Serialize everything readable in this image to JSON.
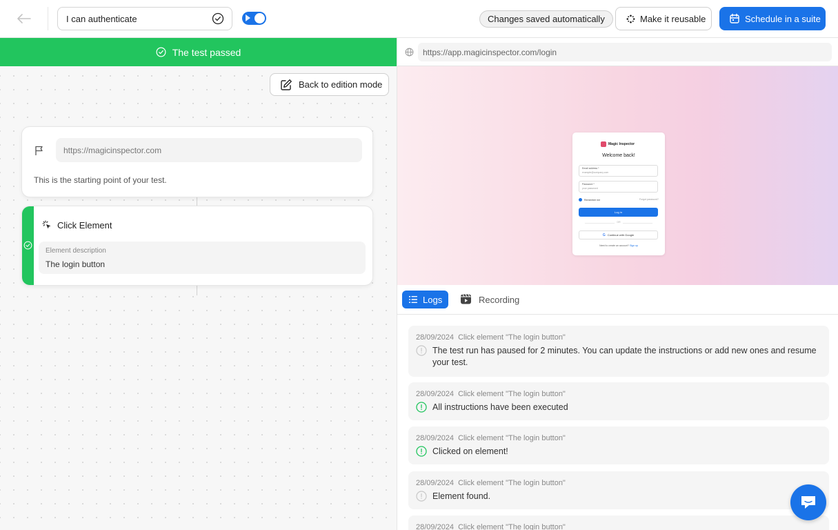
{
  "header": {
    "test_title": "I can authenticate",
    "saved_status": "Changes saved automatically",
    "reuse_label": "Make it reusable",
    "schedule_label": "Schedule in a suite"
  },
  "left": {
    "banner_text": "The test passed",
    "edit_mode_label": "Back to edition mode",
    "start_card": {
      "url": "https://magicinspector.com",
      "description": "This is the starting point of your test."
    },
    "step_card": {
      "title": "Click Element",
      "field_label": "Element description",
      "field_value": "The login button"
    }
  },
  "right": {
    "url": "https://app.magicinspector.com/login",
    "preview": {
      "brand": "Magic Inspector",
      "welcome": "Welcome back!",
      "email_label": "Email address *",
      "email_placeholder": "example@company.com",
      "password_label": "Password *",
      "password_placeholder": "your password",
      "remember": "Remember me",
      "forgot": "Forgot password?",
      "login_button": "Log in",
      "or": "OR",
      "google_button": "Continue with Google",
      "signup_prompt": "Need to create an account?",
      "signup_link": "Sign up"
    },
    "tabs": {
      "logs": "Logs",
      "recording": "Recording"
    },
    "logs": [
      {
        "date": "28/09/2024",
        "action": "Click element \"The login button\"",
        "message": "The test run has paused for 2 minutes. You can update the instructions or add new ones and resume your test.",
        "status": "info"
      },
      {
        "date": "28/09/2024",
        "action": "Click element \"The login button\"",
        "message": "All instructions have been executed",
        "status": "success"
      },
      {
        "date": "28/09/2024",
        "action": "Click element \"The login button\"",
        "message": "Clicked on element!",
        "status": "success"
      },
      {
        "date": "28/09/2024",
        "action": "Click element \"The login button\"",
        "message": "Element found.",
        "status": "info"
      },
      {
        "date": "28/09/2024",
        "action": "Click element \"The login button\"",
        "message": "",
        "status": "info"
      }
    ]
  },
  "colors": {
    "accent": "#1a73e8",
    "success": "#22c55e"
  }
}
